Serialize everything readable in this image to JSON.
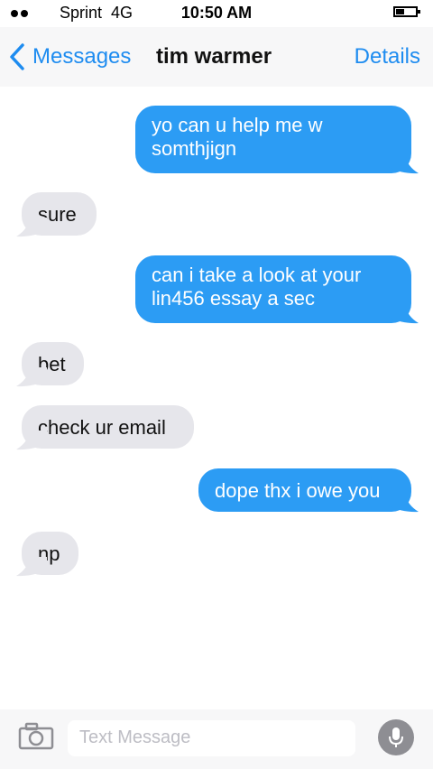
{
  "status": {
    "carrier": "Sprint",
    "network": "4G",
    "time": "10:50 AM"
  },
  "nav": {
    "back_label": "Messages",
    "title": "tim warmer",
    "details_label": "Details"
  },
  "messages": [
    {
      "direction": "sent",
      "lines": [
        "yo can u help me w",
        "somthjign"
      ]
    },
    {
      "direction": "received",
      "lines": [
        "sure"
      ]
    },
    {
      "direction": "sent",
      "lines": [
        "can i take a look at your",
        "lin456 essay a sec"
      ]
    },
    {
      "direction": "received",
      "lines": [
        "bet"
      ]
    },
    {
      "direction": "received",
      "lines": [
        "check ur email"
      ]
    },
    {
      "direction": "sent",
      "lines": [
        "dope thx i owe you"
      ]
    },
    {
      "direction": "received",
      "lines": [
        "np"
      ]
    }
  ],
  "input": {
    "placeholder": "Text Message"
  },
  "icons": {
    "back": "chevron-left-icon",
    "camera": "camera-icon",
    "mic": "microphone-icon"
  },
  "colors": {
    "accent": "#1e8cf0",
    "sent_bubble": "#2c9cf4",
    "received_bubble": "#e6e6eb"
  }
}
